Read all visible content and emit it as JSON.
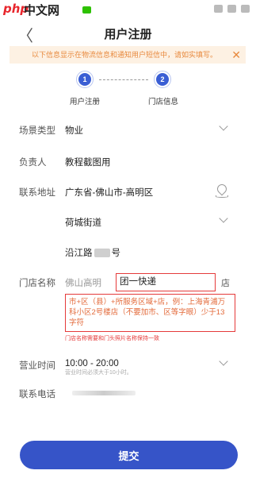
{
  "status_bar": {
    "logo": "php",
    "site_name": "中文网",
    "time": ""
  },
  "nav": {
    "back_symbol": "〈",
    "title": "用户注册"
  },
  "notice": {
    "text": "以下信息显示在物流信息和通知用户短信中，请如实填写。",
    "close_symbol": "✕"
  },
  "steps": [
    {
      "number": "1",
      "label": "用户注册"
    },
    {
      "number": "2",
      "label": "门店信息"
    }
  ],
  "form": {
    "scene_type": {
      "label": "场景类型",
      "value": "物业"
    },
    "owner": {
      "label": "负责人",
      "value": "教程截图用"
    },
    "address": {
      "label": "联系地址",
      "value": "广东省-佛山市-高明区"
    },
    "street": {
      "value": "荷城街道"
    },
    "road": {
      "value_prefix": "沿江路",
      "value_suffix": "号"
    },
    "store_name": {
      "label": "门店名称",
      "prefix": "佛山高明",
      "input_value": "团一快递",
      "suffix": "店"
    },
    "store_hint": "市+区（县）+所服务区域+店，例：上海青浦万科小区2号楼店（不要加市、区等字眼）少于13字符",
    "store_hint_small": "门店名称需要和门头照片名称保持一致",
    "hours": {
      "label": "营业时间",
      "value": "10:00 - 20:00",
      "sub": "营业时间必须大于10小时。"
    },
    "phone": {
      "label": "联系电话"
    }
  },
  "submit_label": "提交",
  "colors": {
    "accent": "#3654c8",
    "highlight_border": "#e53a3a",
    "notice_bg": "#fdf1e3",
    "notice_text": "#e8893d"
  }
}
